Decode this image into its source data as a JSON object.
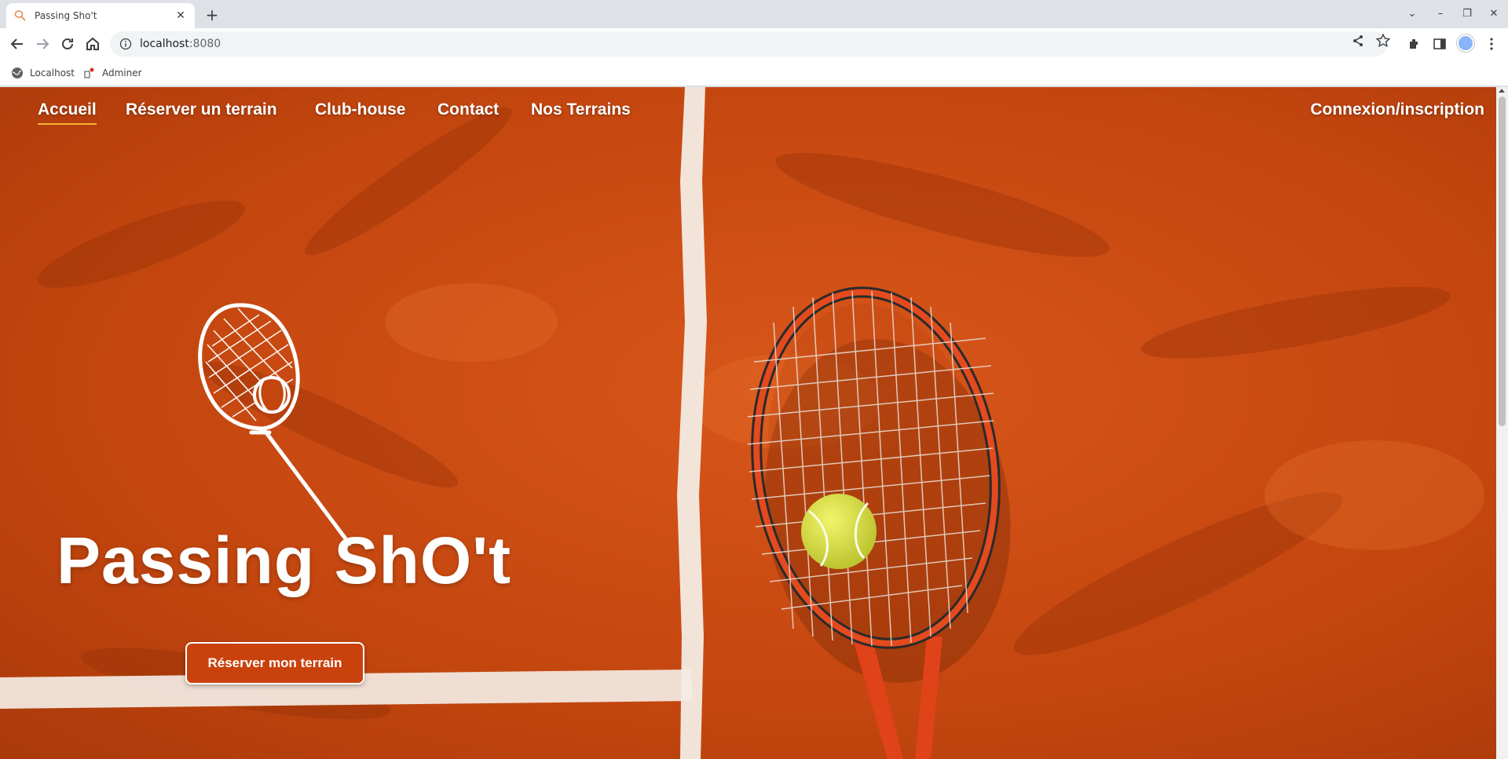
{
  "browser": {
    "tab_title": "Passing Sho't",
    "url_host": "localhost",
    "url_port": ":8080",
    "bookmarks": [
      {
        "label": "Localhost",
        "icon": "globe-icon"
      },
      {
        "label": "Adminer",
        "icon": "adminer-icon"
      }
    ]
  },
  "page": {
    "nav_links": [
      {
        "label": "Accueil",
        "active": true
      },
      {
        "label": "Réserver un terrain",
        "active": false
      },
      {
        "label": "Club-house",
        "active": false
      },
      {
        "label": "Contact",
        "active": false
      },
      {
        "label": "Nos Terrains",
        "active": false
      }
    ],
    "login_label": "Connexion/inscription",
    "hero_title": "Passing ShO't",
    "cta_label": "Réserver mon terrain",
    "colors": {
      "clay": "#c3460f",
      "accent_underline": "#f7b232",
      "button": "#c9420d",
      "ball": "#d9e23a"
    }
  }
}
